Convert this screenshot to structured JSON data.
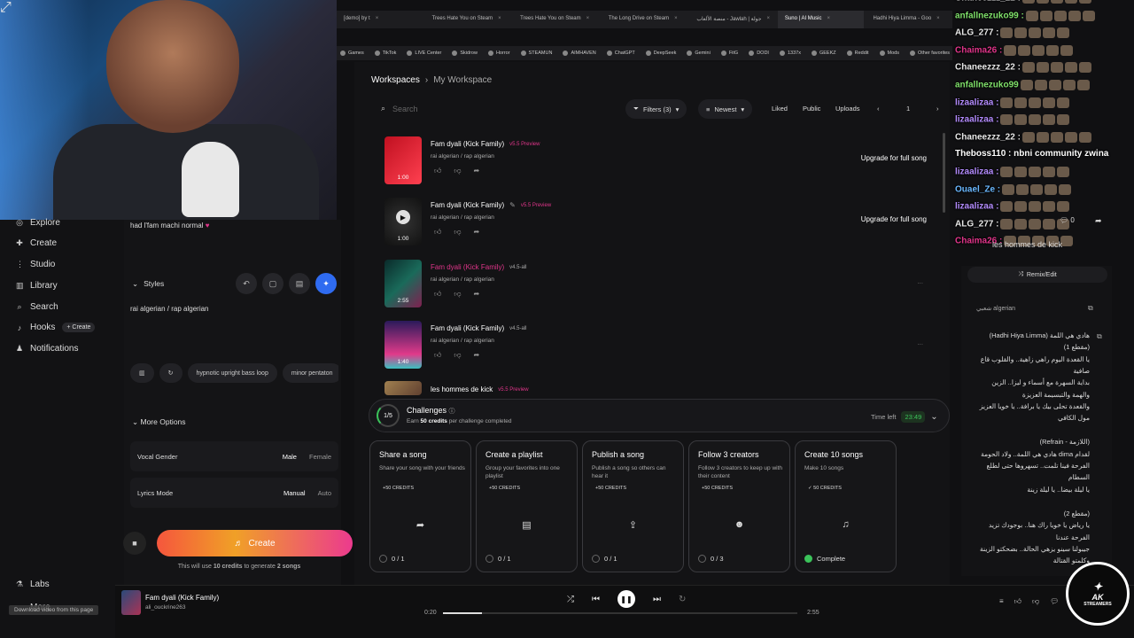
{
  "browser": {
    "tabs": [
      {
        "label": "[demo] by t"
      },
      {
        "label": "Trees Hate You on Steam"
      },
      {
        "label": "Trees Hate You on Steam"
      },
      {
        "label": "The Long Drive on Steam"
      },
      {
        "label": "منصة الألعاب - Jawlah | جولة"
      },
      {
        "label": "Suno | AI Music"
      },
      {
        "label": "Hadhi Hiya Limma - Goo"
      }
    ],
    "bookmarks": [
      "Games",
      "TikTok",
      "LIVE Center",
      "Skidrow",
      "Horror",
      "STEAMUN",
      "AIMHAVEN",
      "ChatGPT",
      "DeepSeek",
      "Gemini",
      "FitG",
      "DODI",
      "1337x",
      "GEEKZ",
      "Reddit",
      "Mods",
      "Other favorites"
    ]
  },
  "sidebar": {
    "items": [
      {
        "label": "Explore",
        "icon": "compass-icon"
      },
      {
        "label": "Create",
        "icon": "plus-icon"
      },
      {
        "label": "Studio",
        "icon": "studio-icon"
      },
      {
        "label": "Library",
        "icon": "library-icon"
      },
      {
        "label": "Search",
        "icon": "search-icon"
      },
      {
        "label": "Hooks",
        "icon": "hooks-icon"
      },
      {
        "label": "Notifications",
        "icon": "bell-icon"
      },
      {
        "label": "Labs",
        "icon": "flask-icon"
      },
      {
        "label": "More",
        "icon": "more-icon"
      }
    ],
    "hooks_create": "+ Create"
  },
  "create_panel": {
    "lyric_line": "had l'fam machi normal",
    "styles_label": "Styles",
    "styles_value": "rai algerian / rap algerian",
    "tags": [
      "hypnotic upright bass loop",
      "minor pentaton"
    ],
    "more_options": "More Options",
    "vocal_gender": {
      "label": "Vocal Gender",
      "options": [
        "Male",
        "Female"
      ]
    },
    "lyrics_mode": {
      "label": "Lyrics Mode",
      "options": [
        "Manual",
        "Auto"
      ]
    },
    "create_label": "Create",
    "credits_note": {
      "pre": "This will use ",
      "credits": "10 credits",
      "mid": " to generate ",
      "songs": "2 songs"
    }
  },
  "main": {
    "breadcrumb": {
      "root": "Workspaces",
      "current": "My Workspace"
    },
    "search_placeholder": "Search",
    "filters": "Filters (3)",
    "sort": "Newest",
    "liked": "Liked",
    "public": "Public",
    "uploads": "Uploads",
    "page": "1",
    "songs": [
      {
        "title": "Fam dyali (Kick Family)",
        "version": "v5.5 Preview",
        "genre": "rai algerian / rap algerian",
        "duration": "1:00",
        "action": "Upgrade for full song"
      },
      {
        "title": "Fam dyali (Kick Family)",
        "version": "v5.5 Preview",
        "genre": "rai algerian / rap algerian",
        "duration": "1:00",
        "action": "Upgrade for full song"
      },
      {
        "title": "Fam dyali (Kick Family)",
        "version": "v4.5-all",
        "genre": "rai algerian / rap algerian",
        "duration": "2:55",
        "action": "..."
      },
      {
        "title": "Fam dyali (Kick Family)",
        "version": "v4.5-all",
        "genre": "rai algerian / rap algerian",
        "duration": "1:40",
        "action": "..."
      },
      {
        "title": "les hommes de kick",
        "version": "v5.5 Preview",
        "genre": "",
        "duration": "",
        "action": ""
      }
    ]
  },
  "challenges": {
    "progress": "1/5",
    "title": "Challenges",
    "subtitle": {
      "pre": "Earn ",
      "credits": "50 credits",
      "post": " per challenge completed"
    },
    "time_left_label": "Time left",
    "time_left": "23:49",
    "cards": [
      {
        "title": "Share a song",
        "desc": "Share your song with your friends",
        "credits": "+50 CREDITS",
        "icon": "share-icon",
        "glyph": "➦",
        "progress": "0 / 1",
        "done": false
      },
      {
        "title": "Create a playlist",
        "desc": "Group your favorites into one playlist",
        "credits": "+50 CREDITS",
        "icon": "playlist-icon",
        "glyph": "▤",
        "progress": "0 / 1",
        "done": false
      },
      {
        "title": "Publish a song",
        "desc": "Publish a song so others can hear it",
        "credits": "+50 CREDITS",
        "icon": "upload-icon",
        "glyph": "⇪",
        "progress": "0 / 1",
        "done": false
      },
      {
        "title": "Follow 3 creators",
        "desc": "Follow 3 creators to keep up with their content",
        "credits": "+50 CREDITS",
        "icon": "follow-icon",
        "glyph": "☻",
        "progress": "0 / 3",
        "done": false
      },
      {
        "title": "Create 10 songs",
        "desc": "Make 10 songs",
        "credits": "✓ 50 CREDITS",
        "icon": "music-note-icon",
        "glyph": "♫",
        "progress": "Complete",
        "done": true
      }
    ]
  },
  "chat": [
    {
      "user": "Chaneezzz_22 :",
      "color": "#e8e8e8"
    },
    {
      "user": "anfallnezuko99 :",
      "color": "#7fe06a"
    },
    {
      "user": "ALG_277 :",
      "color": "#e8e8e8"
    },
    {
      "user": "Chaima26 :",
      "color": "#e0358a"
    },
    {
      "user": "Chaneezzz_22 :",
      "color": "#e8e8e8"
    },
    {
      "user": "anfallnezuko99",
      "color": "#7fe06a"
    },
    {
      "user": "lizaalizaa :",
      "color": "#b48cff"
    },
    {
      "user": "lizaalizaa :",
      "color": "#b48cff"
    },
    {
      "user": "Chaneezzz_22 :",
      "color": "#e8e8e8"
    },
    {
      "user": "Theboss110 : nbni community zwina",
      "color": "#ffffff"
    },
    {
      "user": "lizaalizaa :",
      "color": "#b48cff"
    },
    {
      "user": "Ouael_Ze :",
      "color": "#6ab8ff"
    },
    {
      "user": "lizaalizaa :",
      "color": "#b48cff"
    },
    {
      "user": "ALG_277 :",
      "color": "#e8e8e8"
    },
    {
      "user": "Chaima26 :",
      "color": "#e0358a"
    }
  ],
  "right_panel": {
    "song_title": "les hommes de kick",
    "comments": "0",
    "remix": "Remix/Edit",
    "genre": "شعبي algerian",
    "lyrics": [
      "هادي هي اللمة (Hadhi Hiya Limma)",
      "(مقطع 1)",
      "يا القعدة اليوم راهي زاهية.. والقلوب قاع",
      "صافية",
      "بداية السهرة مع أسماء و ليزا.. الزين",
      "والهمة والتبسيمة العزيزة",
      "والقعدة تحلى بيك يا برافة.. يا خويا العزيز",
      "مول الكافي",
      "(اللازمة - Refrain)",
      "لقدام dima هادي هي اللمة.. ولاد الحومة",
      "الفرحة فينا تلمت.. تسهروها حتى لطلع",
      "السطام",
      "يا ليلة بيضا.. يا ليلة زينة",
      "(مقطع 2)",
      "يا رياض يا خويا راك هنا.. بوجودك تزيد",
      "الفرحة عندنا",
      "جيبولنا سينو يزهي الحالة.. بضحكتو الزينة",
      "وكلمتو القتالة"
    ]
  },
  "player": {
    "title": "Fam dyali (Kick Family)",
    "artist": "ali_ouckrine263",
    "current": "0:20",
    "total": "2:55",
    "progress": 0.11
  },
  "overlay": {
    "download_bar": "Download video from this page",
    "logo_main": "AK",
    "logo_sub": "STREAMERS"
  },
  "colors": {
    "accent_blue": "#2f6bf0",
    "pink": "#e0358a",
    "green": "#3bc35a"
  }
}
